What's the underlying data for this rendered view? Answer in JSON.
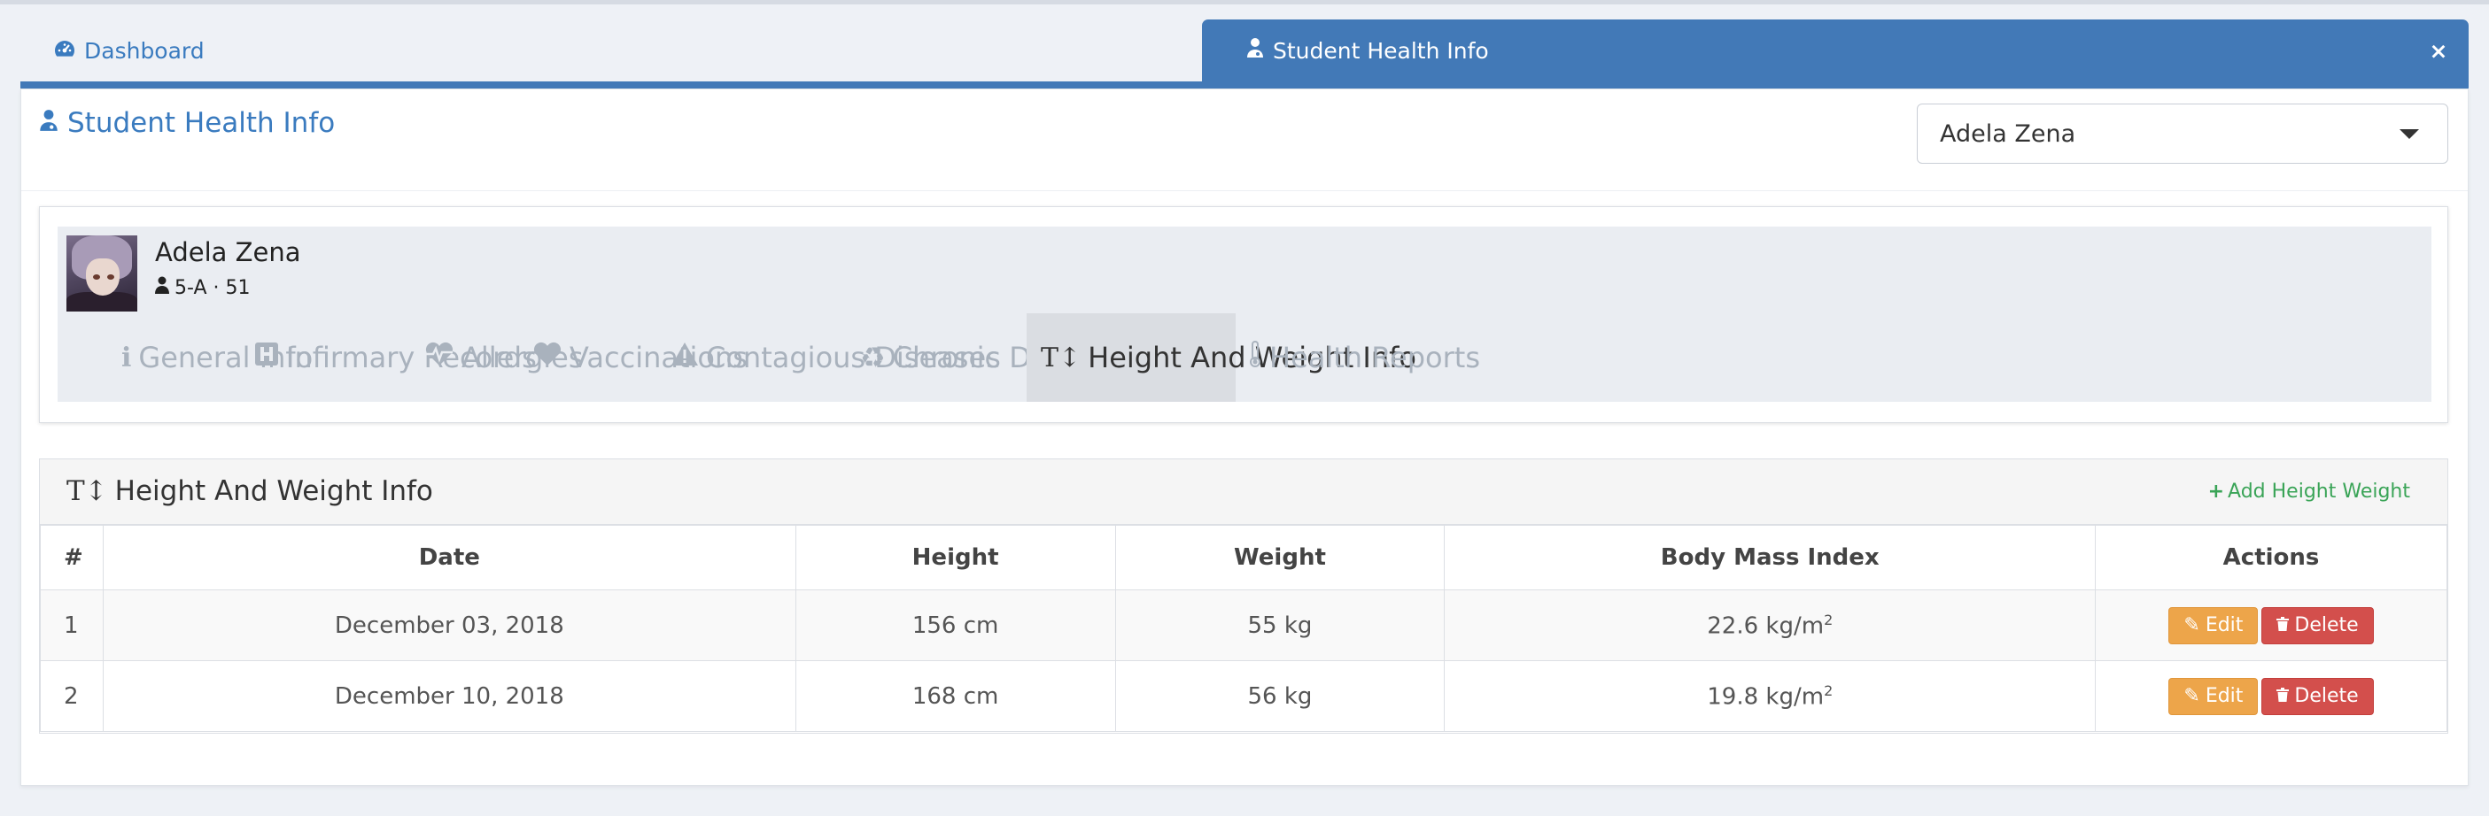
{
  "tabs": {
    "dashboard_label": "Dashboard",
    "active_label": "Student Health Info",
    "close_glyph": "×"
  },
  "panel": {
    "title": "Student Health Info",
    "student_select_value": "Adela Zena"
  },
  "student": {
    "name": "Adela Zena",
    "class_info": "5-A · 51"
  },
  "subnav": [
    {
      "label": "General Info",
      "icon": "info-icon"
    },
    {
      "label": "Infirmary Records",
      "icon": "hospital-icon"
    },
    {
      "label": "Allergies",
      "icon": "heartbeat-icon"
    },
    {
      "label": "Vaccinations",
      "icon": "heart-icon"
    },
    {
      "label": "Contagious Diseases",
      "icon": "warning-icon"
    },
    {
      "label": "Chronic Diseases",
      "icon": "recycle-icon"
    },
    {
      "label": "Height And Weight Info",
      "icon": "text-height-icon"
    },
    {
      "label": "Health Reports",
      "icon": "thermometer-icon"
    }
  ],
  "height_weight": {
    "title": "Height And Weight Info",
    "add_label": "Add Height Weight",
    "columns": [
      "#",
      "Date",
      "Height",
      "Weight",
      "Body Mass Index",
      "Actions"
    ],
    "rows": [
      {
        "num": "1",
        "date": "December 03, 2018",
        "height": "156 cm",
        "weight": "55 kg",
        "bmi": "22.6 kg/m",
        "bmi_sup": "2"
      },
      {
        "num": "2",
        "date": "December 10, 2018",
        "height": "168 cm",
        "weight": "56 kg",
        "bmi": "19.8 kg/m",
        "bmi_sup": "2"
      }
    ],
    "edit_label": "Edit",
    "delete_label": "Delete"
  },
  "colors": {
    "primary": "#4279b7",
    "link": "#3a7bbf",
    "success": "#3aa457",
    "warning": "#eda54a",
    "danger": "#d34f4c"
  }
}
